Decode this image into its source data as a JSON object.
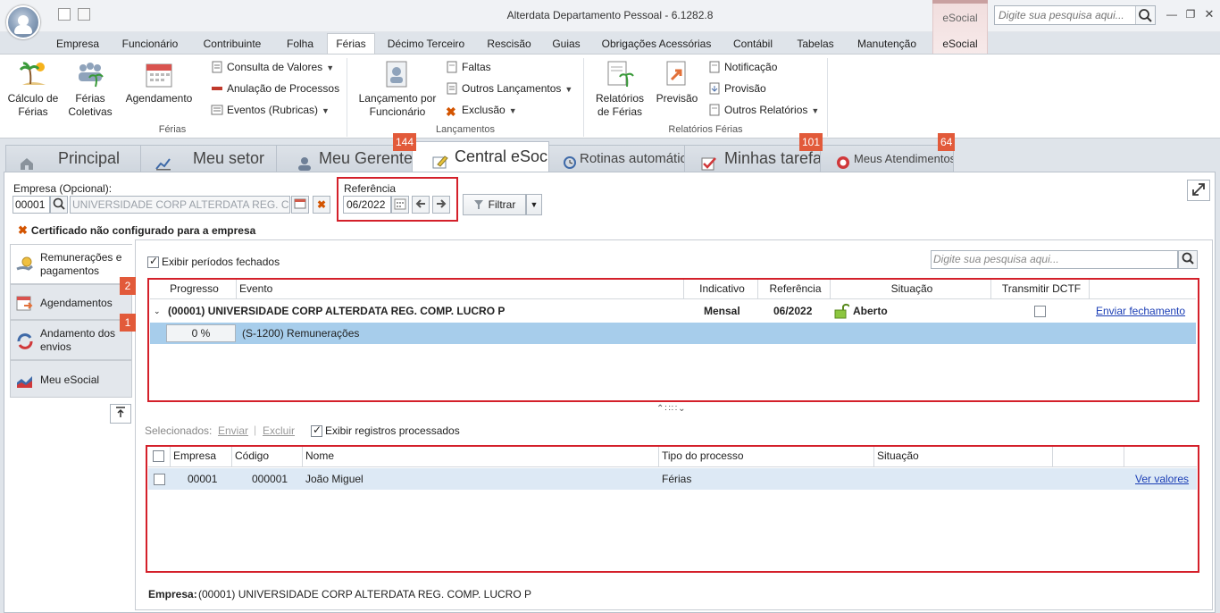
{
  "window": {
    "title": "Alterdata Departamento Pessoal - 6.1282.8",
    "context_tab": "eSocial",
    "search_placeholder": "Digite sua pesquisa aqui..."
  },
  "ribbon_tabs": [
    "Empresa",
    "Funcionário",
    "Contribuinte",
    "Folha",
    "Férias",
    "Décimo Terceiro",
    "Rescisão",
    "Guias",
    "Obrigações Acessórias",
    "Contábil",
    "Tabelas",
    "Manutenção",
    "eSocial"
  ],
  "ribbon": {
    "ferias_group": {
      "label": "Férias",
      "calculo": "Cálculo de Férias",
      "coletivas": "Férias Coletivas",
      "agendamento": "Agendamento",
      "consulta": "Consulta de Valores",
      "anulacao": "Anulação de Processos",
      "eventos": "Eventos (Rubricas)"
    },
    "lancamentos_group": {
      "label": "Lançamentos",
      "por_funcionario": "Lançamento por Funcionário",
      "faltas": "Faltas",
      "outros": "Outros Lançamentos",
      "exclusao": "Exclusão"
    },
    "relatorios_group": {
      "label": "Relatórios Férias",
      "relatorios": "Relatórios de Férias",
      "previsao": "Previsão",
      "notificacao": "Notificação",
      "provisao": "Provisão",
      "outros": "Outros Relatórios"
    }
  },
  "page_tabs": [
    {
      "label": "Principal"
    },
    {
      "label": "Meu setor"
    },
    {
      "label": "Meu Gerente",
      "badge": "144"
    },
    {
      "label": "Central eSocial"
    },
    {
      "label": "Rotinas automáticas"
    },
    {
      "label": "Minhas tarefas",
      "badge": "101"
    },
    {
      "label": "Meus Atendimentos",
      "badge": "64"
    }
  ],
  "filters": {
    "empresa_label": "Empresa (Opcional):",
    "empresa_code": "00001",
    "empresa_name": "UNIVERSIDADE CORP ALTERDATA REG. COMP. LUCRO P",
    "referencia_label": "Referência",
    "referencia_value": "06/2022",
    "filtrar": "Filtrar"
  },
  "certificado_warning": "Certificado não configurado para a empresa",
  "side_menu": [
    {
      "label": "Remunerações e pagamentos"
    },
    {
      "label": "Agendamentos",
      "badge": "2"
    },
    {
      "label": "Andamento dos envios",
      "badge": "1"
    },
    {
      "label": "Meu eSocial"
    }
  ],
  "main": {
    "exibir_fechados": "Exibir períodos fechados",
    "search_placeholder": "Digite sua pesquisa aqui...",
    "columns": [
      "Progresso",
      "Evento",
      "Indicativo",
      "Referência",
      "Situação",
      "Transmitir DCTF"
    ],
    "group_row": {
      "title": "(00001) UNIVERSIDADE CORP ALTERDATA REG. COMP. LUCRO P",
      "indicativo": "Mensal",
      "referencia": "06/2022",
      "situacao": "Aberto",
      "action": "Enviar fechamento"
    },
    "event_row": {
      "progress": "0 %",
      "progress_value": 0,
      "evento": "(S-1200) Remunerações"
    },
    "toolbar": {
      "selecionados": "Selecionados:",
      "enviar": "Enviar",
      "excluir": "Excluir",
      "exibir_processados": "Exibir registros processados"
    },
    "lower_columns": [
      "Empresa",
      "Código",
      "Nome",
      "Tipo do processo",
      "Situação"
    ],
    "lower_rows": [
      {
        "empresa": "00001",
        "codigo": "000001",
        "nome": "João Miguel",
        "tipo": "Férias",
        "situacao": "",
        "action": "Ver valores"
      }
    ],
    "footer_label": "Empresa:",
    "footer_value": "(00001) UNIVERSIDADE CORP ALTERDATA REG. COMP. LUCRO P"
  }
}
